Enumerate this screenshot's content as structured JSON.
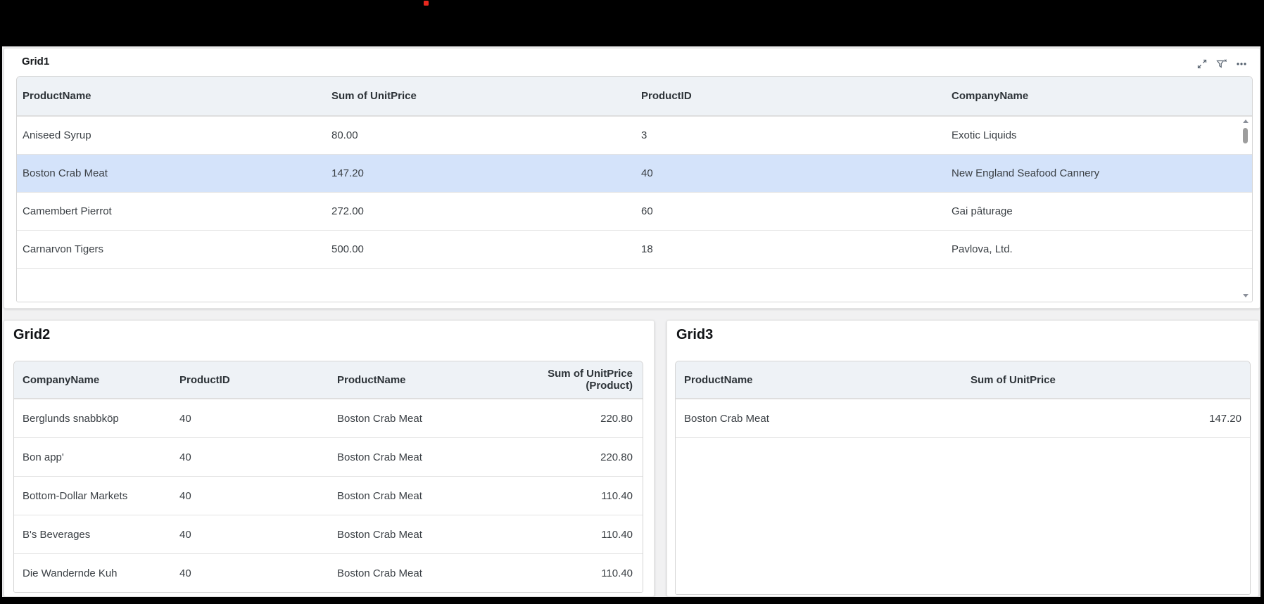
{
  "chrome": {
    "bar_color": "#000000",
    "indicator_dot_color": "#e8281e"
  },
  "colors": {
    "page_bg": "#f1f1f2",
    "panel_bg": "#ffffff",
    "table_header_bg": "#eef2f6",
    "selected_row_bg": "#d4e3fa",
    "table_border": "#d5d5d5",
    "row_divider": "#e3e3e3",
    "text": "#3a3f44",
    "title_text": "#16191c",
    "icon_color": "#5b6673"
  },
  "grid1": {
    "title": "Grid1",
    "toolbar_icons": [
      "expand-icon",
      "clear-filter-icon",
      "more-options-icon"
    ],
    "columns": [
      "ProductName",
      "Sum of UnitPrice",
      "ProductID",
      "CompanyName"
    ],
    "selected_row_index": 1,
    "rows": [
      [
        "Aniseed Syrup",
        "80.00",
        "3",
        "Exotic Liquids"
      ],
      [
        "Boston Crab Meat",
        "147.20",
        "40",
        "New England Seafood Cannery"
      ],
      [
        "Camembert Pierrot",
        "272.00",
        "60",
        "Gai pâturage"
      ],
      [
        "Carnarvon Tigers",
        "500.00",
        "18",
        "Pavlova, Ltd."
      ]
    ]
  },
  "grid2": {
    "title": "Grid2",
    "columns": [
      "CompanyName",
      "ProductID",
      "ProductName",
      "Sum of UnitPrice (Product)"
    ],
    "rows": [
      [
        "Berglunds snabbköp",
        "40",
        "Boston Crab Meat",
        "220.80"
      ],
      [
        "Bon app'",
        "40",
        "Boston Crab Meat",
        "220.80"
      ],
      [
        "Bottom-Dollar Markets",
        "40",
        "Boston Crab Meat",
        "110.40"
      ],
      [
        "B's Beverages",
        "40",
        "Boston Crab Meat",
        "110.40"
      ],
      [
        "Die Wandernde Kuh",
        "40",
        "Boston Crab Meat",
        "110.40"
      ]
    ]
  },
  "grid3": {
    "title": "Grid3",
    "columns": [
      "ProductName",
      "Sum of UnitPrice"
    ],
    "rows": [
      [
        "Boston Crab Meat",
        "147.20"
      ]
    ]
  }
}
